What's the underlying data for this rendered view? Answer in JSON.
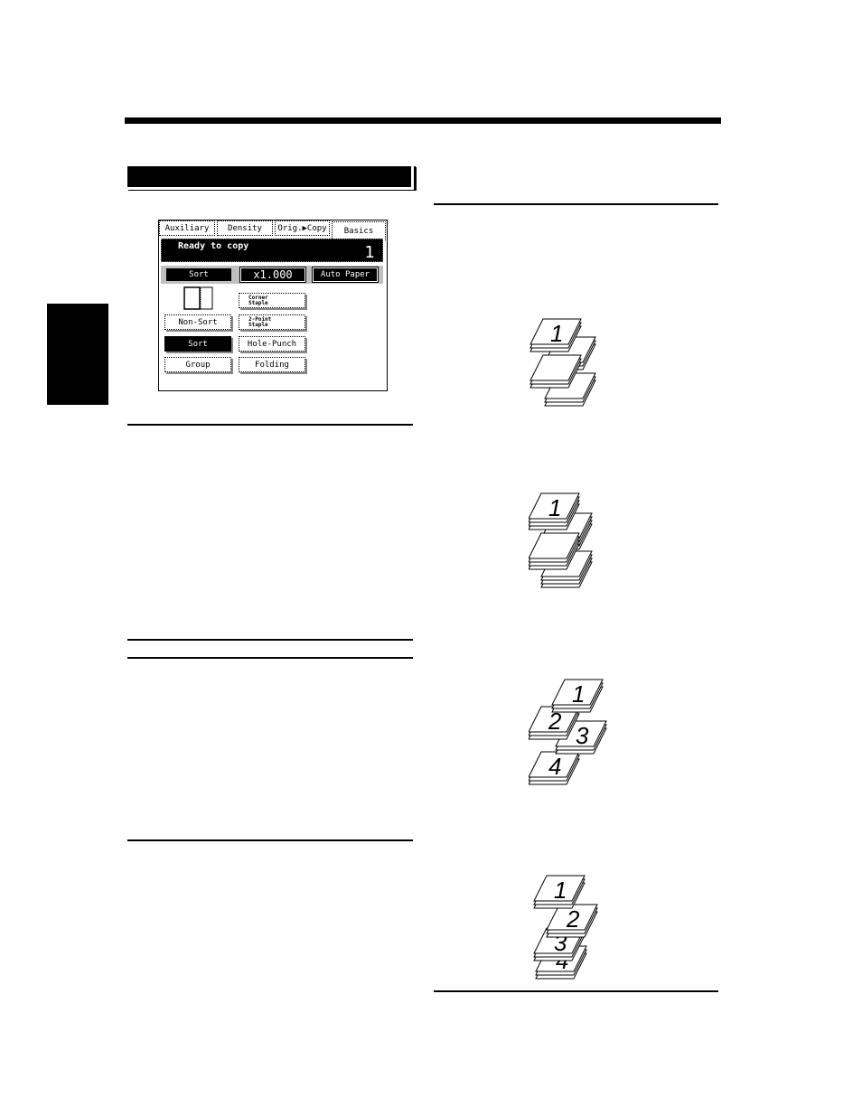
{
  "page": {
    "section_header_text": "",
    "side_tab_text": ""
  },
  "panel": {
    "tabs": [
      {
        "label": "Auxiliary",
        "active": false
      },
      {
        "label": "Density",
        "active": false
      },
      {
        "label": "Orig.▶Copy",
        "active": false
      },
      {
        "label": "Basics",
        "active": true
      }
    ],
    "status_message": "Ready to copy",
    "copy_count": "1",
    "summary": {
      "finish_mode": "Sort",
      "zoom_ratio": "x1.000",
      "paper": "Auto Paper"
    },
    "finishing_modes": [
      {
        "label": "Non-Sort",
        "selected": false
      },
      {
        "label": "Sort",
        "selected": true
      },
      {
        "label": "Group",
        "selected": false
      }
    ],
    "finishing_options": [
      {
        "line1": "Corner",
        "line2": "Staple"
      },
      {
        "line1": "2-Point",
        "line2": "Staple"
      },
      {
        "label": "Hole-Punch"
      },
      {
        "label": "Folding"
      }
    ],
    "colors": {
      "ink": "#000000",
      "paper": "#ffffff"
    }
  },
  "illustrations": [
    {
      "name": "non-sort-stacks",
      "visible_digits": [
        "1"
      ]
    },
    {
      "name": "sort-stacks",
      "visible_digits": [
        "1"
      ]
    },
    {
      "name": "offset-sort-stacks",
      "visible_digits": [
        "1",
        "2",
        "3",
        "4"
      ]
    },
    {
      "name": "group-stacks",
      "visible_digits": [
        "1",
        "2",
        "3",
        "4"
      ]
    }
  ]
}
